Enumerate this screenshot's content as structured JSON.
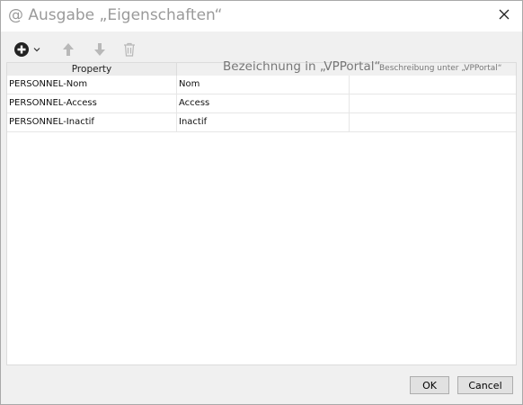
{
  "window": {
    "title": "@ Ausgabe „Eigenschaften“"
  },
  "toolbar": {
    "items": [
      {
        "icon": "add-icon"
      },
      {
        "icon": "chevron-down-icon"
      },
      {
        "icon": "arrow-up-icon"
      },
      {
        "icon": "arrow-down-icon"
      },
      {
        "icon": "trash-icon"
      }
    ]
  },
  "grid": {
    "columns": {
      "property": "Property",
      "bezeichnung": "Bezeichnung in „VPPortal“",
      "beschreibung": "Beschreibung unter „VPPortal“"
    },
    "rows": [
      {
        "property": "PERSONNEL-Nom",
        "bezeichnung": "Nom",
        "beschreibung": ""
      },
      {
        "property": "PERSONNEL-Access",
        "bezeichnung": "Access",
        "beschreibung": ""
      },
      {
        "property": "PERSONNEL-Inactif",
        "bezeichnung": "Inactif",
        "beschreibung": ""
      }
    ]
  },
  "buttons": {
    "ok": "OK",
    "cancel": "Cancel"
  },
  "colors": {
    "dialog_bg": "#f0f0f0",
    "title_text": "#9a9a9a",
    "icon_dark": "#222222",
    "icon_disabled": "#b8b8b8"
  }
}
